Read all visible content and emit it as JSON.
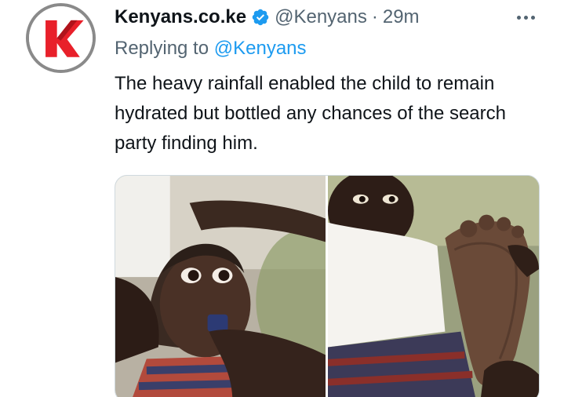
{
  "author": {
    "name": "Kenyans.co.ke",
    "handle": "@Kenyans",
    "separator": "·",
    "time": "29m",
    "verified_icon": "verified-badge-icon",
    "avatar_logo": "kenyans-k-logo"
  },
  "reply": {
    "prefix": "Replying to",
    "target": "@Kenyans"
  },
  "tweet": {
    "text": "The heavy rainfall enabled the child to remain hydrated but bottled any chances of the search party finding him."
  },
  "media": {
    "photos": [
      {
        "icon": "child-face-photo"
      },
      {
        "icon": "child-foot-photo"
      }
    ]
  },
  "colors": {
    "link": "#1d9bf0",
    "muted": "#536471",
    "text": "#0f1419",
    "logo_red": "#e8202a"
  }
}
